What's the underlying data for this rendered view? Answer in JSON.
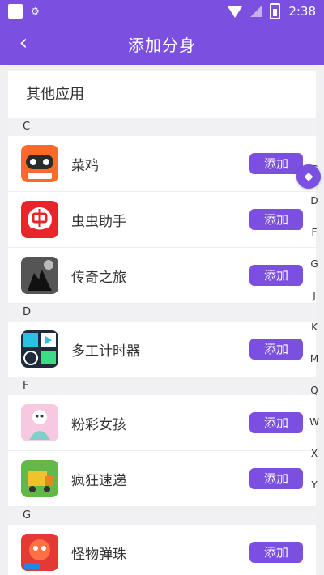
{
  "status": {
    "time": "2:38"
  },
  "header": {
    "title": "添加分身"
  },
  "card": {
    "title": "其他应用"
  },
  "sections": [
    {
      "letter": "C",
      "apps": [
        {
          "name": "菜鸡",
          "button": "添加"
        },
        {
          "name": "虫虫助手",
          "button": "添加"
        },
        {
          "name": "传奇之旅",
          "button": "添加"
        }
      ]
    },
    {
      "letter": "D",
      "apps": [
        {
          "name": "多工计时器",
          "button": "添加"
        }
      ]
    },
    {
      "letter": "F",
      "apps": [
        {
          "name": "粉彩女孩",
          "button": "添加"
        },
        {
          "name": "疯狂速递",
          "button": "添加"
        }
      ]
    },
    {
      "letter": "G",
      "apps": [
        {
          "name": "怪物弹珠",
          "button": "添加"
        }
      ]
    }
  ],
  "index_letters": [
    "C",
    "D",
    "F",
    "G",
    "J",
    "K",
    "M",
    "Q",
    "W",
    "X",
    "Y"
  ],
  "colors": {
    "accent": "#7b4fe0"
  },
  "icons": {
    "back": "chevron-left-icon"
  }
}
